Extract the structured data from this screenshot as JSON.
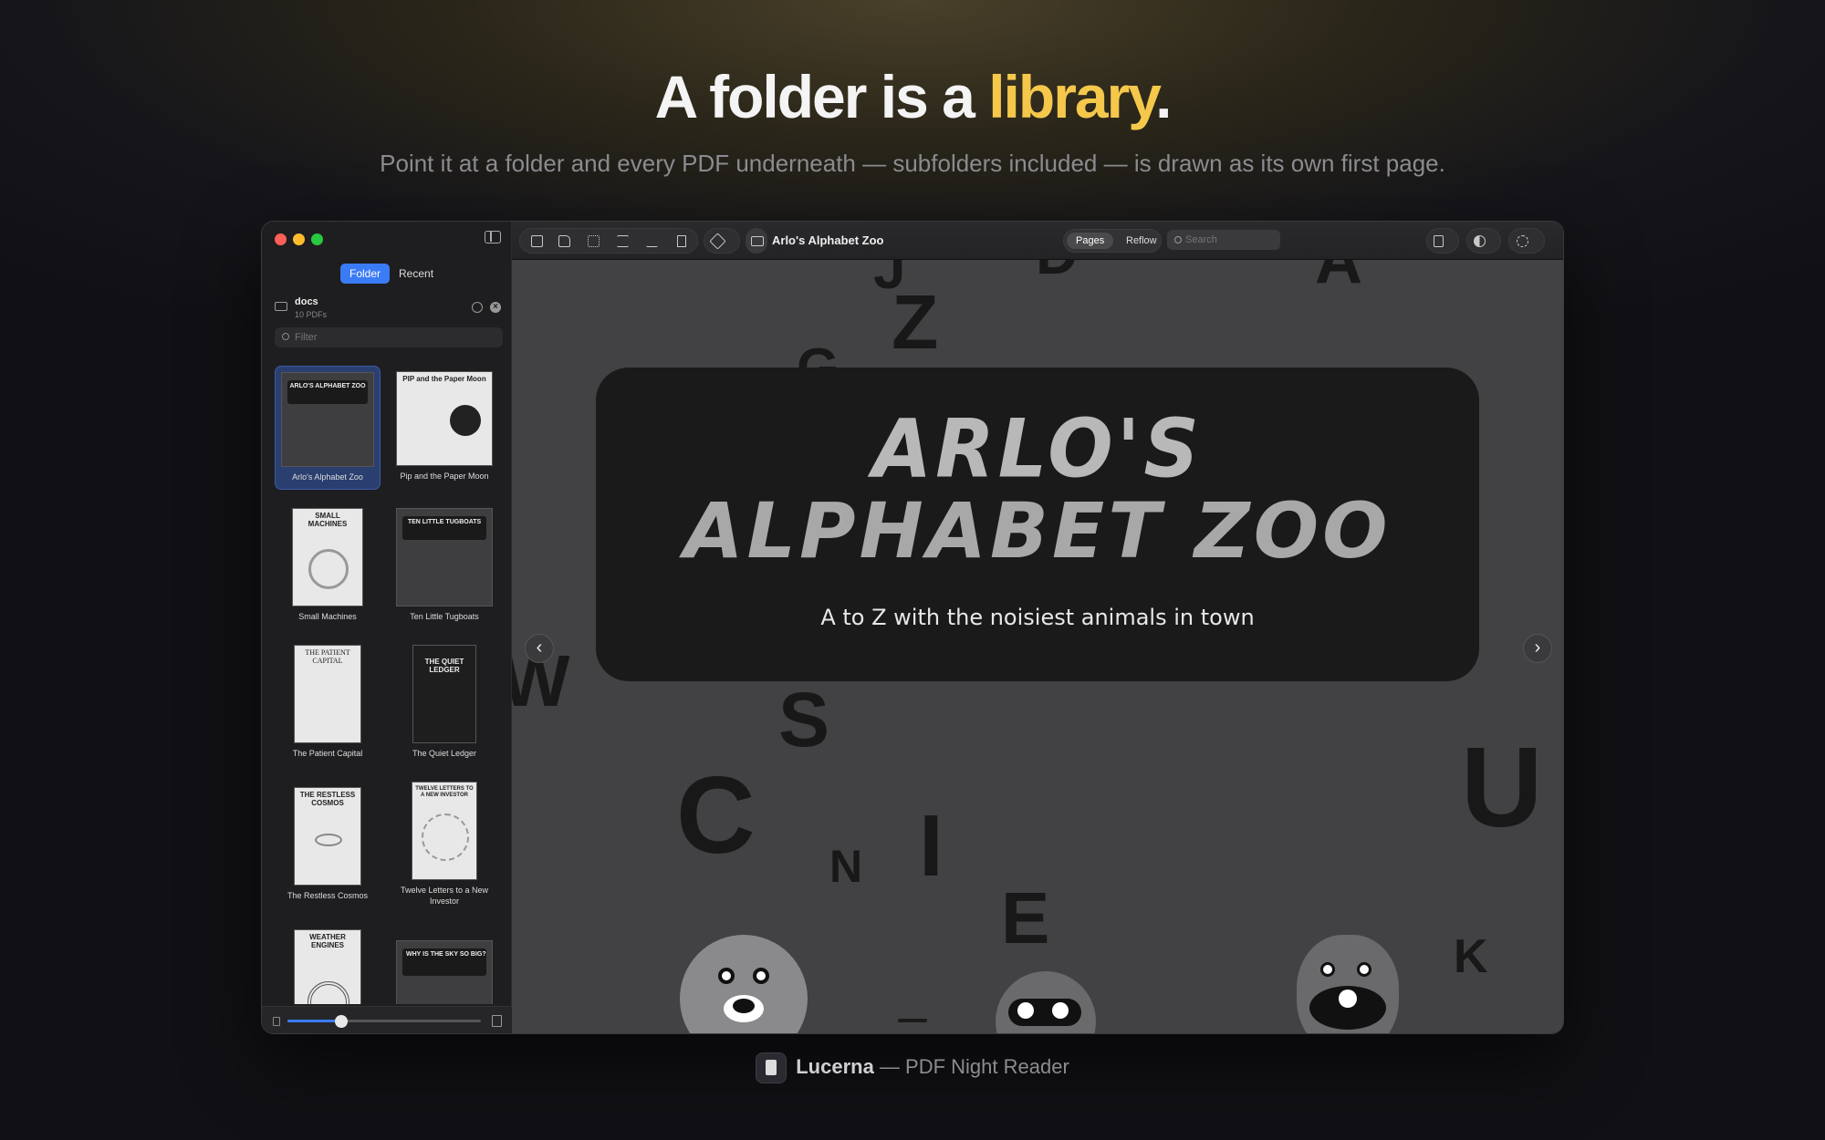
{
  "hero": {
    "headline_pre": "A folder is a ",
    "headline_accent": "library",
    "headline_post": ".",
    "subline": "Point it at a folder and every PDF underneath — subfolders included — is drawn as its own first page."
  },
  "sidebar": {
    "tabs": [
      {
        "label": "Folder",
        "active": true
      },
      {
        "label": "Recent",
        "active": false
      }
    ],
    "folder": {
      "name": "docs",
      "count": "10 PDFs"
    },
    "filter_placeholder": "Filter",
    "items": [
      {
        "title": "Arlo's Alphabet Zoo",
        "cover": "ARLO'S ALPHABET ZOO",
        "selected": true
      },
      {
        "title": "Pip and the Paper Moon",
        "cover": "PIP and the Paper Moon"
      },
      {
        "title": "Small Machines",
        "cover": "SMALL MACHINES"
      },
      {
        "title": "Ten Little Tugboats",
        "cover": "TEN LITTLE TUGBOATS"
      },
      {
        "title": "The Patient Capital",
        "cover": "THE PATIENT CAPITAL"
      },
      {
        "title": "The Quiet Ledger",
        "cover": "THE QUIET LEDGER"
      },
      {
        "title": "The Restless Cosmos",
        "cover": "THE RESTLESS COSMOS"
      },
      {
        "title": "Twelve Letters to a New Investor",
        "cover": "TWELVE LETTERS TO A NEW INVESTOR"
      },
      {
        "title": "",
        "cover": "WEATHER ENGINES"
      },
      {
        "title": "",
        "cover": "WHY IS THE SKY SO BIG?"
      }
    ],
    "zoom_fraction": 0.28
  },
  "toolbar": {
    "doc_title": "Arlo's Alphabet Zoo",
    "view_modes": [
      "Pages",
      "Reflow"
    ],
    "search_placeholder": "Search"
  },
  "page": {
    "title_line1": "ARLO'S",
    "title_line2": "ALPHABET ZOO",
    "subtitle": "A to Z with the noisiest animals in town",
    "letters": [
      "J",
      "D",
      "A",
      "Z",
      "G",
      "F",
      "W",
      "S",
      "C",
      "N",
      "I",
      "E",
      "U",
      "K"
    ]
  },
  "footer": {
    "brand": "Lucerna",
    "tagline": " — PDF Night Reader"
  }
}
